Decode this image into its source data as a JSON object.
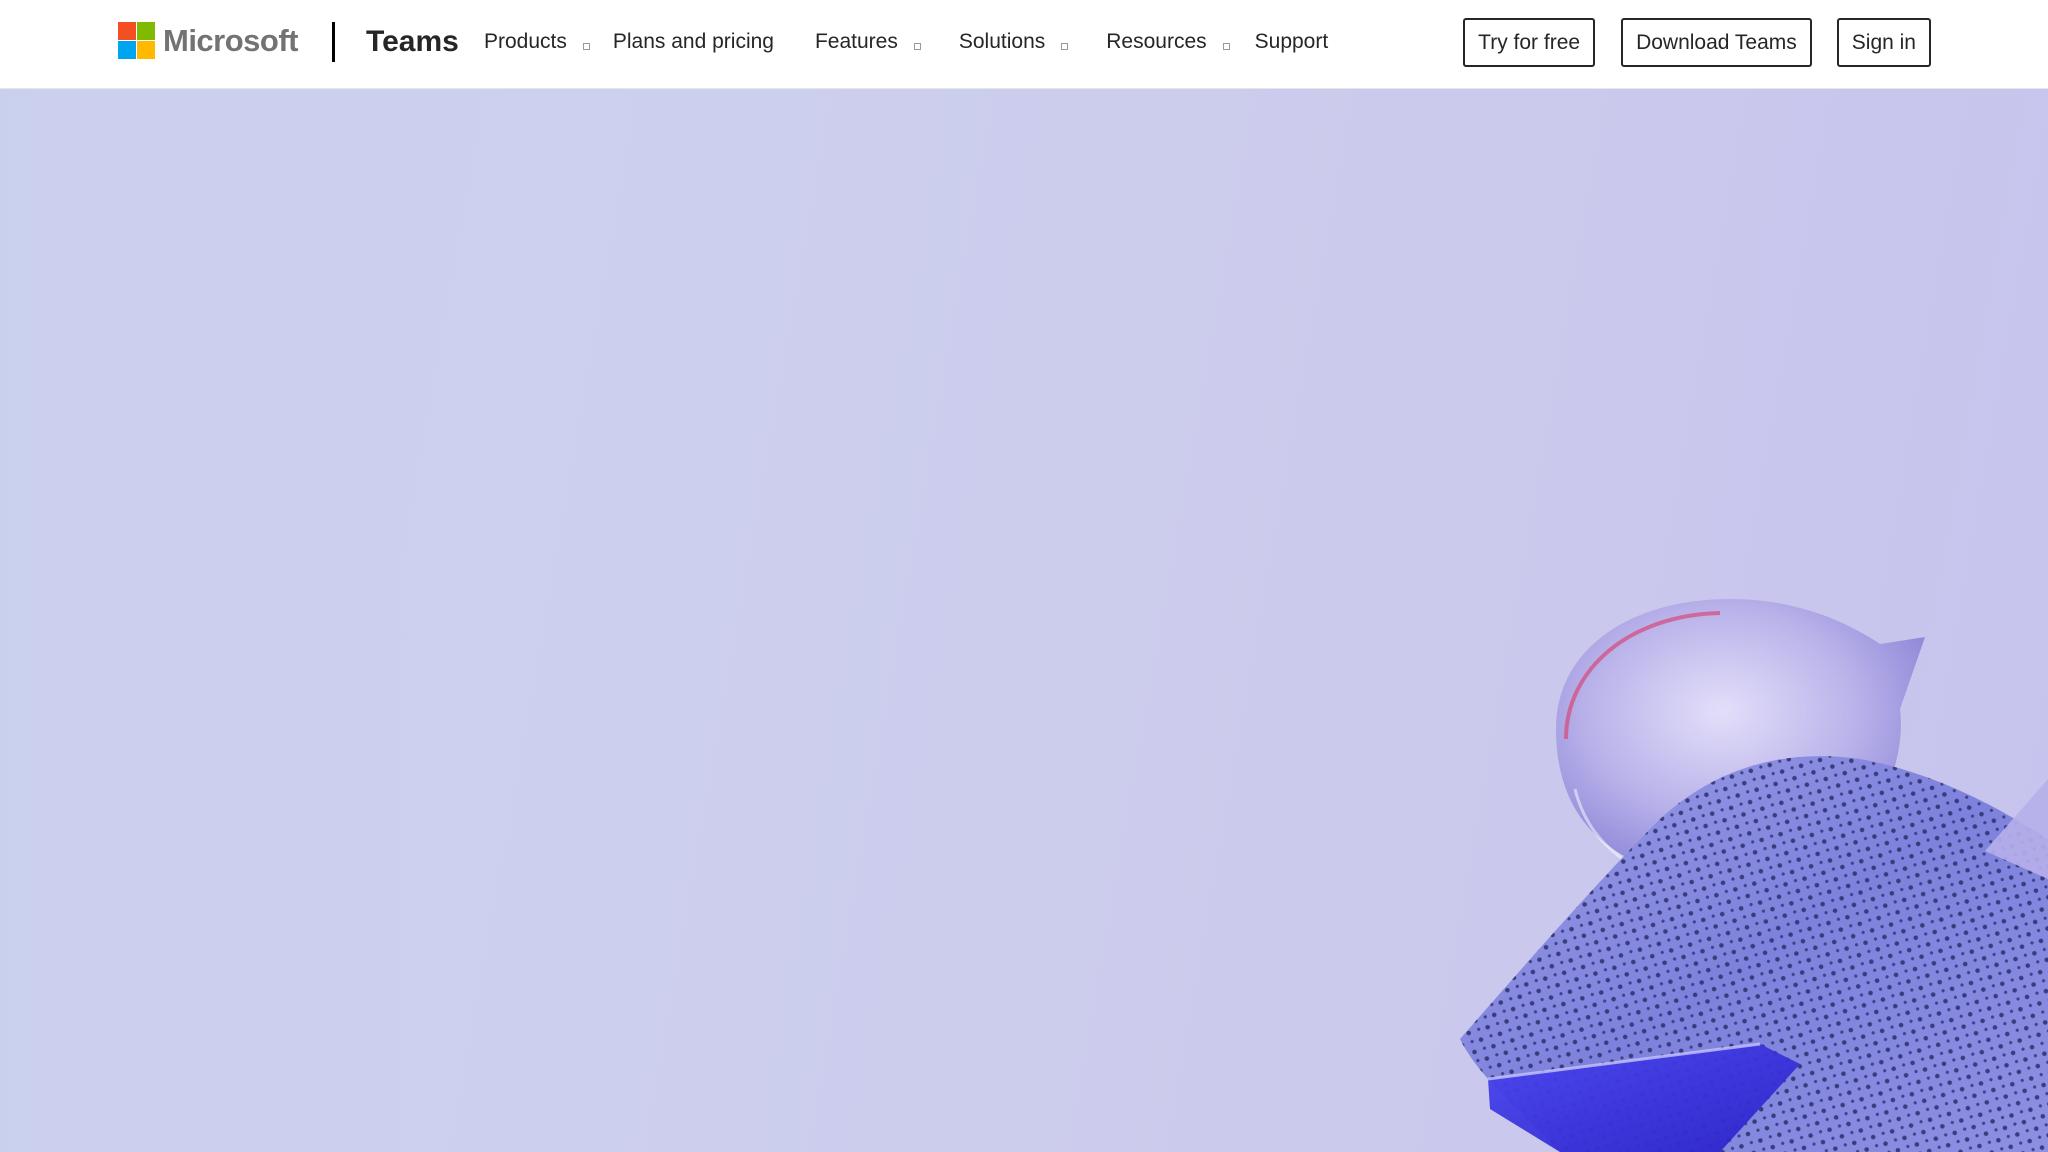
{
  "brand": {
    "company": "Microsoft",
    "product": "Teams",
    "logo_colors": [
      "#f25022",
      "#7fba00",
      "#00a4ef",
      "#ffb900"
    ]
  },
  "nav": {
    "items": [
      {
        "label": "Products",
        "has_dropdown": true
      },
      {
        "label": "Plans and pricing",
        "has_dropdown": false
      },
      {
        "label": "Features",
        "has_dropdown": true
      },
      {
        "label": "Solutions",
        "has_dropdown": true
      },
      {
        "label": "Resources",
        "has_dropdown": true
      },
      {
        "label": "Support",
        "has_dropdown": false
      }
    ]
  },
  "actions": {
    "try_free": "Try for free",
    "download": "Download Teams",
    "sign_in": "Sign in"
  },
  "hero": {
    "background_color": "#cccfee",
    "art": "decorative-3d-shapes"
  }
}
